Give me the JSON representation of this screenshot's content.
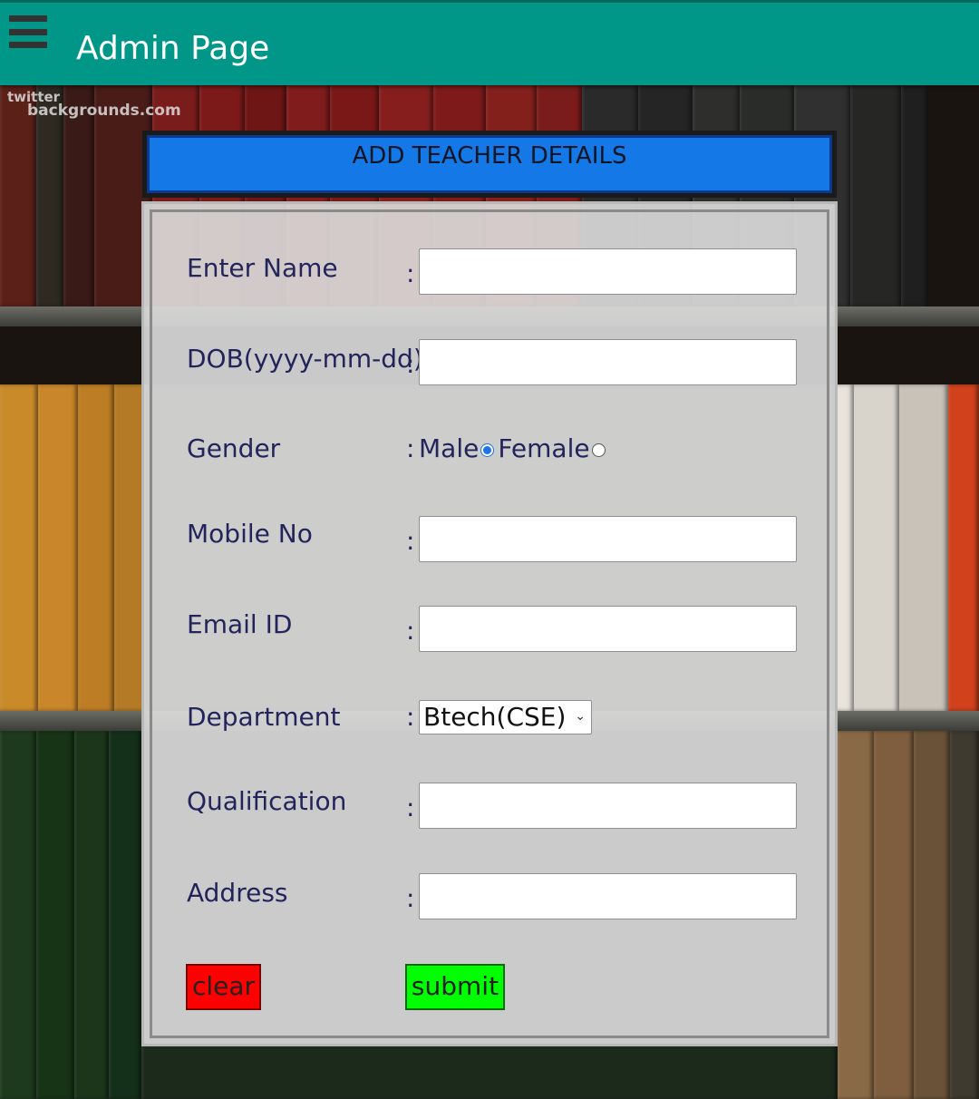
{
  "app": {
    "title": "Admin Page",
    "bar_color": "#009688"
  },
  "background": {
    "watermark_line1": "twitter",
    "watermark_line2": "backgrounds.com"
  },
  "form": {
    "heading": "ADD TEACHER DETAILS",
    "fields": {
      "name": {
        "label": "Enter Name",
        "colon": ":",
        "value": ""
      },
      "dob": {
        "label": "DOB(yyyy-mm-dd)",
        "colon": ":",
        "value": ""
      },
      "gender": {
        "label": "Gender",
        "colon": ":",
        "male": "Male",
        "female": "Female",
        "selected": "Male"
      },
      "mobile": {
        "label": "Mobile No",
        "colon": ":",
        "value": ""
      },
      "email": {
        "label": "Email ID",
        "colon": ":",
        "value": ""
      },
      "department": {
        "label": "Department",
        "colon": ":",
        "value": "Btech(CSE)"
      },
      "qualification": {
        "label": "Qualification",
        "colon": ":",
        "value": ""
      },
      "address": {
        "label": "Address",
        "colon": ":",
        "value": ""
      }
    },
    "buttons": {
      "clear": "clear",
      "submit": "submit"
    },
    "colors": {
      "heading_bg": "#1478e6",
      "clear_bg": "#ff0000",
      "submit_bg": "#00ff00",
      "label": "#24245c"
    }
  }
}
